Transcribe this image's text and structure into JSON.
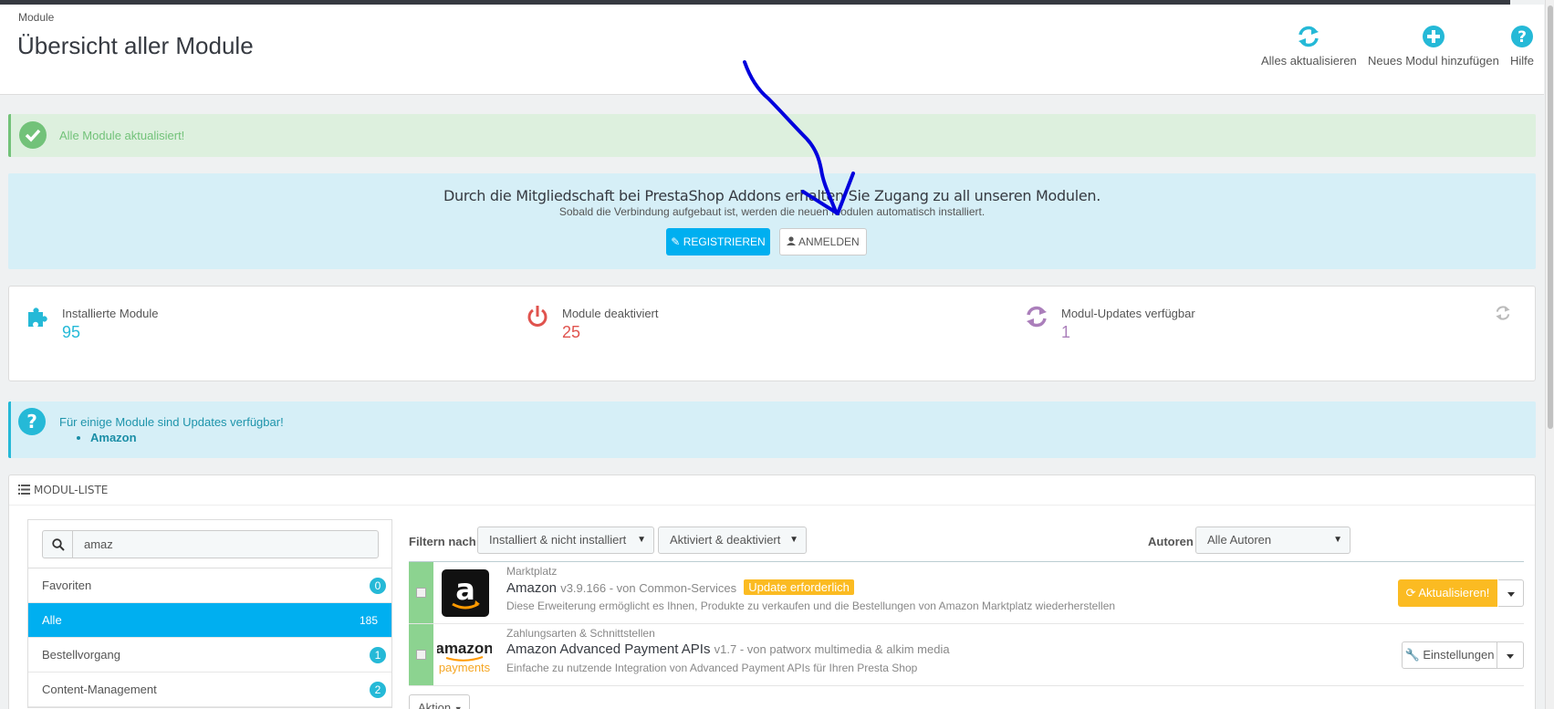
{
  "header": {
    "breadcrumb": "Module",
    "title": "Übersicht aller Module",
    "toolbar": {
      "update_all": "Alles aktualisieren",
      "add_module": "Neues Modul hinzufügen",
      "help": "Hilfe"
    }
  },
  "alerts": {
    "success": "Alle Module aktualisiert!",
    "info_text": "Für einige Module sind Updates verfügbar!",
    "info_items": [
      "Amazon"
    ]
  },
  "addons": {
    "line1": "Durch die Mitgliedschaft bei PrestaShop Addons erhalten Sie Zugang zu all unseren Modulen.",
    "line2": "Sobald die Verbindung aufgebaut ist, werden die neuen Modulen automatisch installiert.",
    "register": "REGISTRIEREN",
    "login": "ANMELDEN"
  },
  "stats": [
    {
      "label": "Installierte Module",
      "value": "95",
      "color": "#25b9d7"
    },
    {
      "label": "Module deaktiviert",
      "value": "25",
      "color": "#e08f95"
    },
    {
      "label": "Modul-Updates verfügbar",
      "value": "1",
      "color": "#ab7fbb"
    }
  ],
  "module_list": {
    "title": "MODUL-LISTE",
    "search_value": "amaz",
    "categories": [
      {
        "label": "Favoriten",
        "count": "0"
      },
      {
        "label": "Alle",
        "count": "185"
      },
      {
        "label": "Bestellvorgang",
        "count": "1"
      },
      {
        "label": "Content-Management",
        "count": "2"
      }
    ],
    "filter_label": "Filtern nach",
    "filter_install": "Installiert & nicht installiert",
    "filter_active": "Aktiviert & deaktiviert",
    "authors_label": "Autoren",
    "authors_value": "Alle Autoren",
    "modules": [
      {
        "category": "Marktplatz",
        "name": "Amazon",
        "version": "v3.9.166 - von Common-Services",
        "badge": "Update erforderlich",
        "description": "Diese Erweiterung ermöglicht es Ihnen, Produkte zu verkaufen und die Bestellungen von Amazon Marktplatz wiederherstellen",
        "action": "Aktualisieren!"
      },
      {
        "category": "Zahlungsarten & Schnittstellen",
        "name": "Amazon Advanced Payment APIs",
        "version": "v1.7 - von patworx multimedia & alkim media",
        "description": "Einfache zu nutzende Integration von Advanced Payment APIs für Ihren Presta Shop",
        "action": "Einstellungen",
        "logo_text_top": "amazon",
        "logo_text_bottom": "payments"
      }
    ],
    "bulk_action": "Aktion"
  },
  "colors": {
    "accent": "#00aff0",
    "success": "#72c279",
    "warning": "#fbbb22",
    "annotation": "#0000dd"
  }
}
